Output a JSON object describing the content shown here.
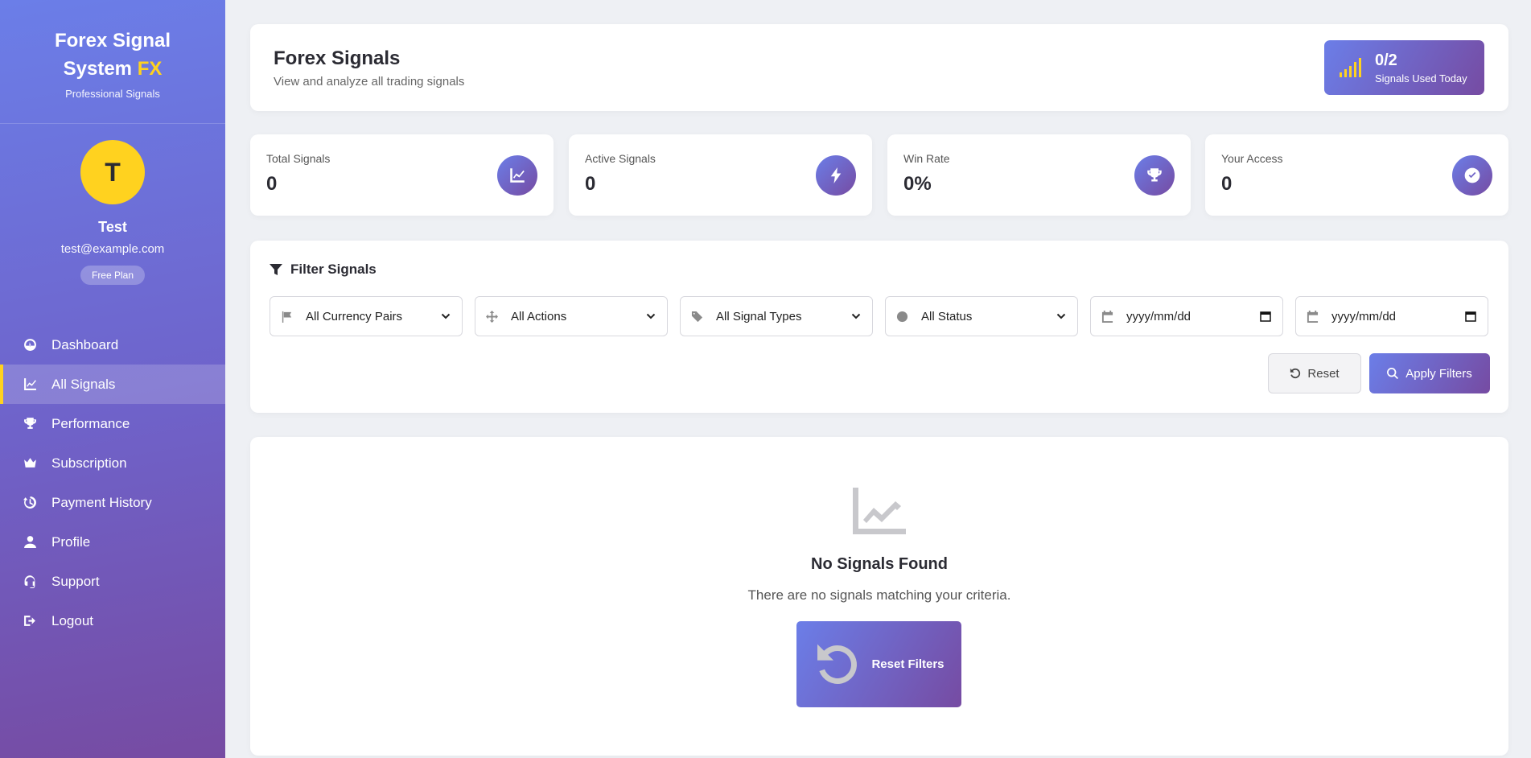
{
  "brand": {
    "title_line1": "Forex Signal",
    "title_line2": "System",
    "title_accent": "FX",
    "subtitle": "Professional Signals"
  },
  "user": {
    "initial": "T",
    "name": "Test",
    "email": "test@example.com",
    "plan": "Free Plan"
  },
  "nav": [
    {
      "label": "Dashboard",
      "icon": "gauge-icon"
    },
    {
      "label": "All Signals",
      "icon": "chart-line-icon",
      "active": true
    },
    {
      "label": "Performance",
      "icon": "trophy-icon"
    },
    {
      "label": "Subscription",
      "icon": "crown-icon"
    },
    {
      "label": "Payment History",
      "icon": "history-icon"
    },
    {
      "label": "Profile",
      "icon": "user-icon"
    },
    {
      "label": "Support",
      "icon": "headset-icon"
    },
    {
      "label": "Logout",
      "icon": "logout-icon"
    }
  ],
  "header": {
    "title": "Forex Signals",
    "subtitle": "View and analyze all trading signals",
    "usage_count": "0/2",
    "usage_label": "Signals Used Today"
  },
  "stats": [
    {
      "label": "Total Signals",
      "value": "0",
      "icon": "chart-line-icon"
    },
    {
      "label": "Active Signals",
      "value": "0",
      "icon": "bolt-icon"
    },
    {
      "label": "Win Rate",
      "value": "0%",
      "icon": "trophy-icon"
    },
    {
      "label": "Your Access",
      "value": "0",
      "icon": "check-circle-icon"
    }
  ],
  "filters": {
    "title": "Filter Signals",
    "currency_pair": "All Currency Pairs",
    "action": "All Actions",
    "signal_type": "All Signal Types",
    "status": "All Status",
    "date_from_placeholder": "yyyy/mm/dd",
    "date_to_placeholder": "yyyy/mm/dd",
    "reset_label": "Reset",
    "apply_label": "Apply Filters"
  },
  "empty_state": {
    "title": "No Signals Found",
    "message": "There are no signals matching your criteria.",
    "button_label": "Reset Filters"
  },
  "colors": {
    "primary_start": "#6b7ee8",
    "primary_end": "#764ba2",
    "accent": "#ffd21f",
    "background": "#eef0f4"
  }
}
